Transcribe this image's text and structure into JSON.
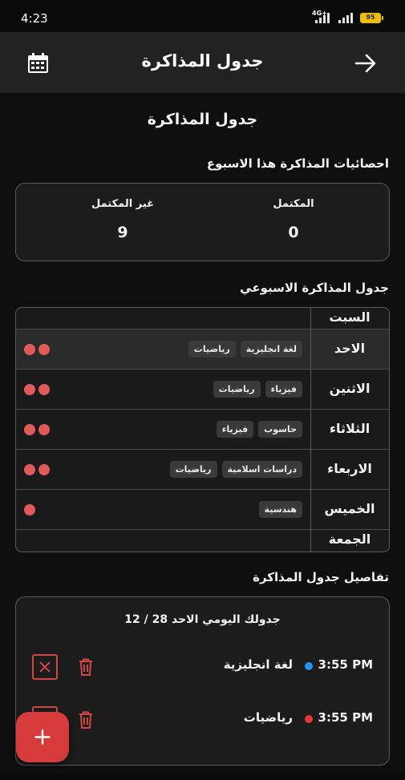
{
  "status": {
    "time": "4:23",
    "network": "4G+",
    "battery": "95"
  },
  "app_bar": {
    "title": "جدول المذاكرة"
  },
  "page": {
    "title": "جدول المذاكرة"
  },
  "stats": {
    "section_title": "احصائيات المذاكرة هذا الاسبوع",
    "completed_label": "المكتمل",
    "completed_value": "0",
    "incomplete_label": "غير المكتمل",
    "incomplete_value": "9"
  },
  "weekly": {
    "section_title": "جدول المذاكرة الاسبوعي",
    "days": [
      {
        "name": "السبت",
        "subjects": [],
        "dots": 0
      },
      {
        "name": "الاحد",
        "subjects": [
          "لغة انجليزية",
          "رياضيات"
        ],
        "dots": 2
      },
      {
        "name": "الاثنين",
        "subjects": [
          "فيزياء",
          "رياضيات"
        ],
        "dots": 2
      },
      {
        "name": "الثلاثاء",
        "subjects": [
          "حاسوب",
          "فيزياء"
        ],
        "dots": 2
      },
      {
        "name": "الاربعاء",
        "subjects": [
          "دراسات اسلامية",
          "رياضيات"
        ],
        "dots": 2
      },
      {
        "name": "الخميس",
        "subjects": [
          "هندسية"
        ],
        "dots": 1
      },
      {
        "name": "الجمعة",
        "subjects": [],
        "dots": 0
      }
    ]
  },
  "details": {
    "section_title": "تفاصيل جدول المذاكرة",
    "header": "جدولك اليومي الاحد 28 / 12",
    "entries": [
      {
        "time": "3:55 PM",
        "subject": "لغة انجليزية",
        "dot_color": "#2196f3"
      },
      {
        "time": "3:55 PM",
        "subject": "رياضيات",
        "dot_color": "#e53935"
      }
    ]
  },
  "colors": {
    "accent": "#d63a3a",
    "dot": "#e05a5a"
  }
}
